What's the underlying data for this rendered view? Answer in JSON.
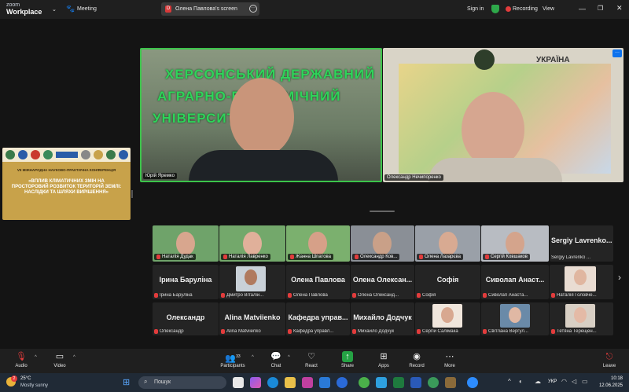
{
  "app": {
    "brand_top": "zoom",
    "brand_bottom": "Workplace",
    "meeting_label": "Meeting"
  },
  "share_tab": {
    "label": "Олена Павлова's screen"
  },
  "header_right": {
    "sign_in": "Sign in",
    "recording": "Recording",
    "view": "View"
  },
  "presentation": {
    "line1": "VII МІЖНАРОДНА НАУКОВО-ПРАКТИЧНА КОНФЕРЕНЦІЯ",
    "line2": "«ВПЛИВ КЛІМАТИЧНИХ ЗМІН НА",
    "line3": "ПРОСТОРОВИЙ РОЗВИТОК ТЕРИТОРІЙ ЗЕМЛІ:",
    "line4": "НАСЛІДКИ ТА ШЛЯХИ ВИРІШЕННЯ»"
  },
  "main_videos": [
    {
      "name": "Юрій Яремко",
      "backdrop": [
        "ХЕРСОНСЬКИЙ ДЕРЖАВНИЙ",
        "АГРАРНО-ЕКОНОМІЧНИЙ",
        "УНІВЕРСИТЕТ"
      ]
    },
    {
      "name": "Олександр Нечипоренко",
      "map_label": "УКРАЇНА"
    }
  ],
  "video_row": [
    {
      "name": "Наталія Дудак"
    },
    {
      "name": "Наталія Лавренко"
    },
    {
      "name": "Жанна Шпатова"
    },
    {
      "name": "Олександр Ков..."
    },
    {
      "name": "Олена Лазарєва"
    },
    {
      "name": "Сергій Ковшаков"
    }
  ],
  "name_tiles": [
    {
      "big": "Sergiy Lavrenko...",
      "small": "Sergiy Lavrenko ..."
    },
    {
      "big": "Ірина Баруліна",
      "small": "Ірина Баруліна"
    },
    {
      "big": "",
      "small": "Дмитро Віталій..."
    },
    {
      "big": "Олена Павлова",
      "small": "Олена Павлова"
    },
    {
      "big": "Олена Олексан...",
      "small": "Олена Олександ..."
    },
    {
      "big": "Софія",
      "small": "Софія"
    },
    {
      "big": "Сиволап Анаст...",
      "small": "Сиволап Анаста..."
    },
    {
      "big": "",
      "small": "Наталія Головче..."
    },
    {
      "big": "Олександр",
      "small": "Олександр"
    },
    {
      "big": "Alina Matviienko",
      "small": "Alina Matviienko"
    },
    {
      "big": "Кафедра управ...",
      "small": "Кафедра управл..."
    },
    {
      "big": "Михайло Додчук",
      "small": "Михайло Додчук"
    },
    {
      "big": "",
      "small": "Сергій Салімака"
    },
    {
      "big": "",
      "small": "Світлана Вергул..."
    },
    {
      "big": "",
      "small": "Тетяна Терещен..."
    }
  ],
  "toolbar": {
    "audio": "Audio",
    "video": "Video",
    "participants": "Participants",
    "participants_count": "33",
    "chat": "Chat",
    "react": "React",
    "share": "Share",
    "apps": "Apps",
    "record": "Record",
    "more": "More",
    "leave": "Leave"
  },
  "taskbar": {
    "temp": "25°C",
    "weather": "Mostly sunny",
    "search": "Пошук",
    "lang": "УКР",
    "time": "10:18",
    "date": "12.06.2025",
    "notif": "2"
  },
  "colors": {
    "accent": "#0e72ed",
    "recording": "#e23c3c",
    "green_frame": "#3cc44a",
    "share_green": "#25a244"
  }
}
